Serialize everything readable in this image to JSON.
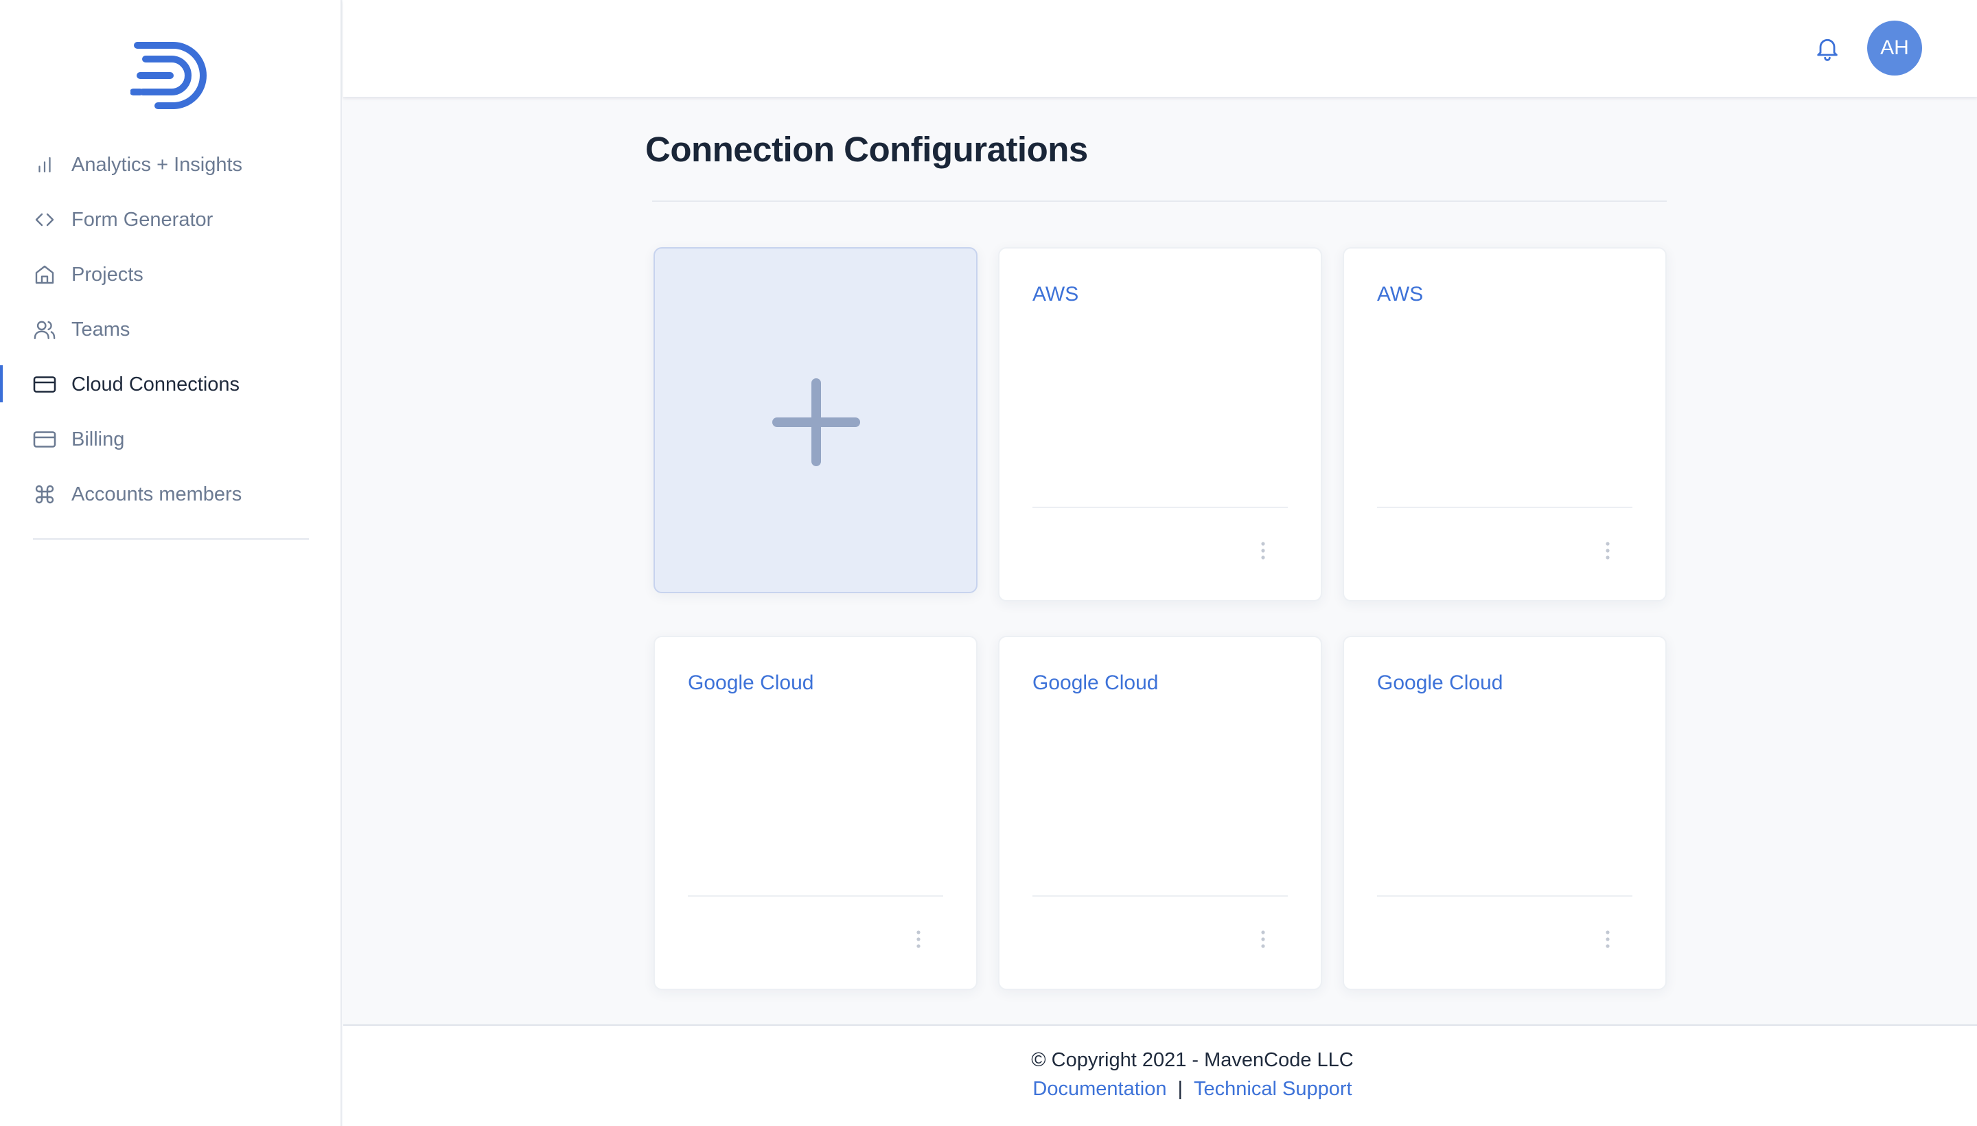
{
  "sidebar": {
    "logo": "mavencode-logo",
    "items": [
      {
        "label": "Analytics + Insights",
        "icon": "bar-chart-icon",
        "active": false
      },
      {
        "label": "Form Generator",
        "icon": "code-icon",
        "active": false
      },
      {
        "label": "Projects",
        "icon": "home-icon",
        "active": false
      },
      {
        "label": "Teams",
        "icon": "users-icon",
        "active": false
      },
      {
        "label": "Cloud Connections",
        "icon": "credit-card-icon",
        "active": true
      },
      {
        "label": "Billing",
        "icon": "credit-card-icon",
        "active": false
      },
      {
        "label": "Accounts members",
        "icon": "command-icon",
        "active": false
      }
    ]
  },
  "header": {
    "notification_icon": "bell-icon",
    "avatar_initials": "AH"
  },
  "main": {
    "title": "Connection Configurations",
    "add_card_icon": "plus-icon",
    "cards": [
      {
        "title": "AWS"
      },
      {
        "title": "AWS"
      },
      {
        "title": "Google Cloud"
      },
      {
        "title": "Google Cloud"
      },
      {
        "title": "Google Cloud"
      }
    ]
  },
  "footer": {
    "copyright": "© Copyright 2021 - MavenCode LLC",
    "documentation_link": "Documentation",
    "separator": "|",
    "support_link": "Technical Support"
  },
  "colors": {
    "accent": "#3d72d8",
    "avatar": "#5b8be0",
    "add_card_bg": "#e6ecf8",
    "plus": "#94a5c4"
  }
}
